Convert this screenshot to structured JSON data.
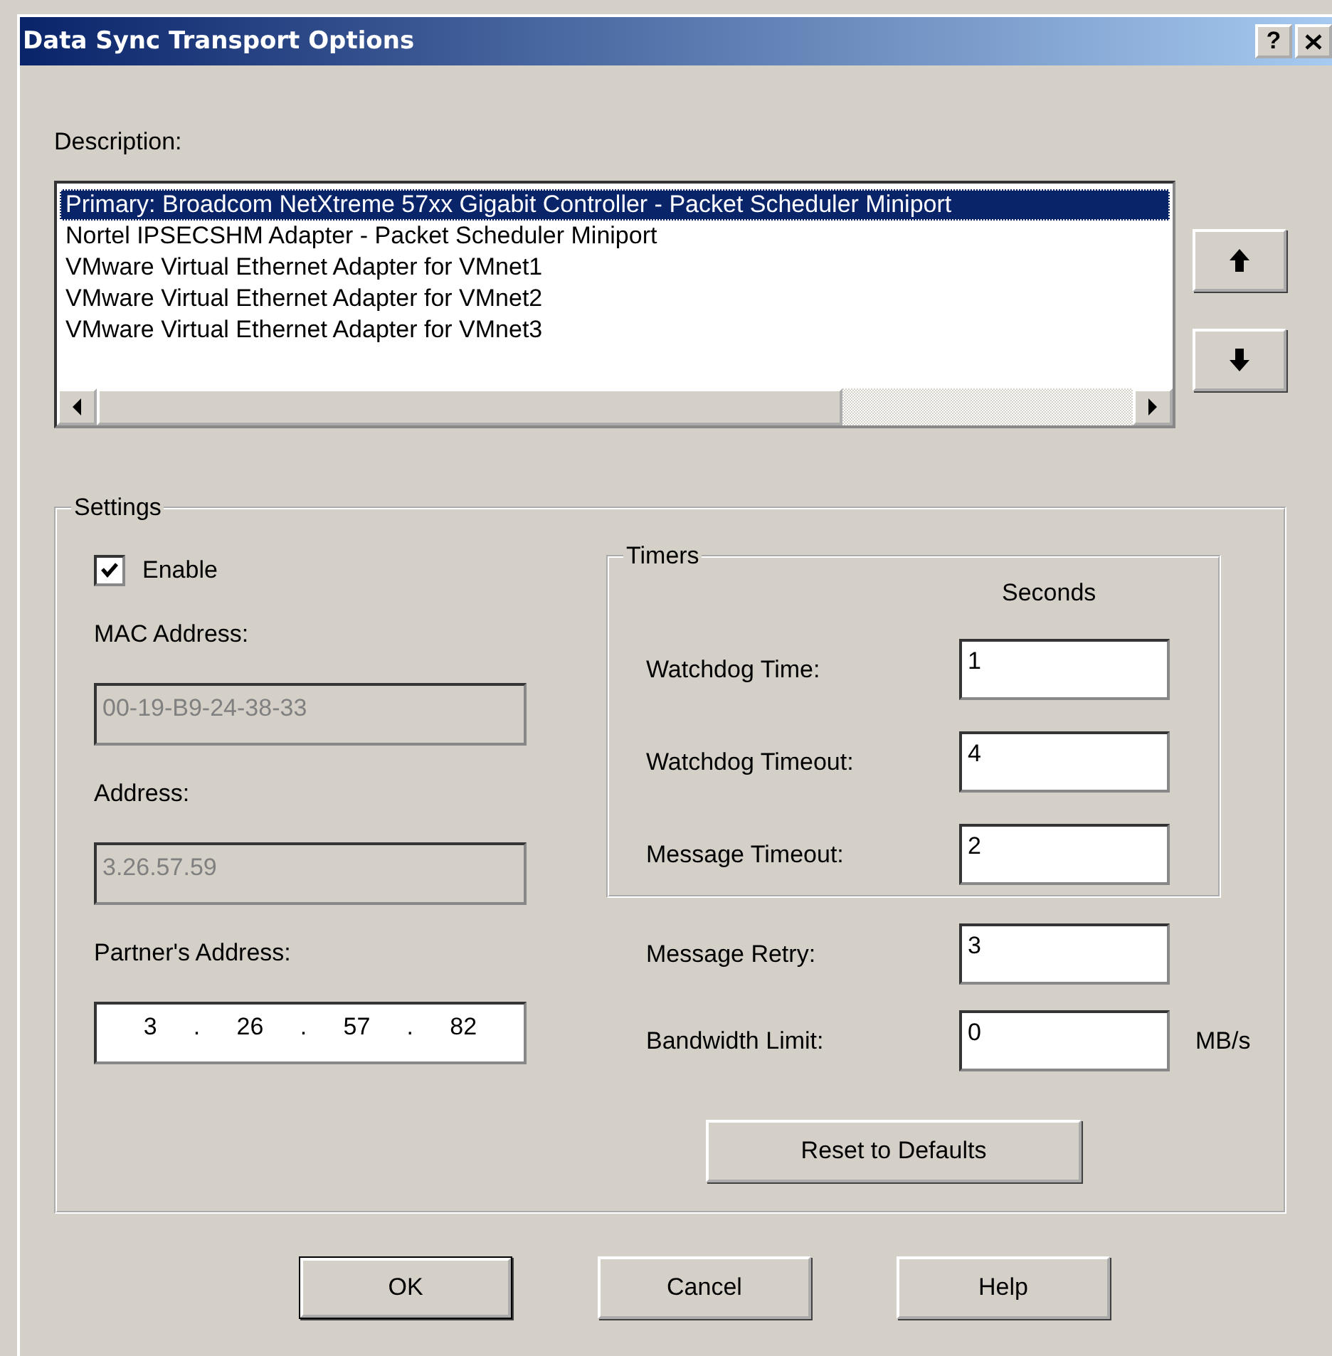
{
  "window": {
    "title": "Data Sync Transport Options",
    "help_button": "?"
  },
  "description": {
    "label": {
      "text": "Description:"
    },
    "items": [
      {
        "text": "Primary: Broadcom NetXtreme 57xx Gigabit Controller - Packet Scheduler Miniport",
        "selected": true
      },
      {
        "text": "Nortel IPSECSHM Adapter - Packet Scheduler Miniport",
        "selected": false
      },
      {
        "text": "VMware Virtual Ethernet Adapter for VMnet1",
        "selected": false
      },
      {
        "text": "VMware Virtual Ethernet Adapter for VMnet2",
        "selected": false
      },
      {
        "text": "VMware Virtual Ethernet Adapter for VMnet3",
        "selected": false
      }
    ]
  },
  "settings": {
    "title": "Settings",
    "enable": {
      "text": "Enable",
      "checked": true
    },
    "mac_address": {
      "label": "MAC Address:",
      "value": "00-19-B9-24-38-33",
      "disabled": true
    },
    "address": {
      "label": "Address:",
      "value": "3.26.57.59",
      "disabled": true
    },
    "partners_address": {
      "label": {
        "text": "Partner's Address:"
      },
      "octets": [
        "3",
        "26",
        "57",
        "82"
      ],
      "separator": "."
    },
    "timers": {
      "title": "Timers",
      "unit_heading": "Seconds",
      "rows": [
        {
          "label": "Watchdog Time:",
          "value": "1"
        },
        {
          "label": "Watchdog Timeout:",
          "value": "4"
        },
        {
          "label": "Message Timeout:",
          "value": "2"
        }
      ]
    },
    "extra_rows": [
      {
        "label": "Message Retry:",
        "value": "3"
      },
      {
        "label": "Bandwidth Limit:",
        "value": "0",
        "unit": "MB/s"
      }
    ],
    "reset_button": {
      "text": "Reset to Defaults"
    }
  },
  "buttons": [
    {
      "text": "OK",
      "default": true
    },
    {
      "text": "Cancel",
      "default": false
    },
    {
      "text": "Help",
      "default": false
    }
  ]
}
